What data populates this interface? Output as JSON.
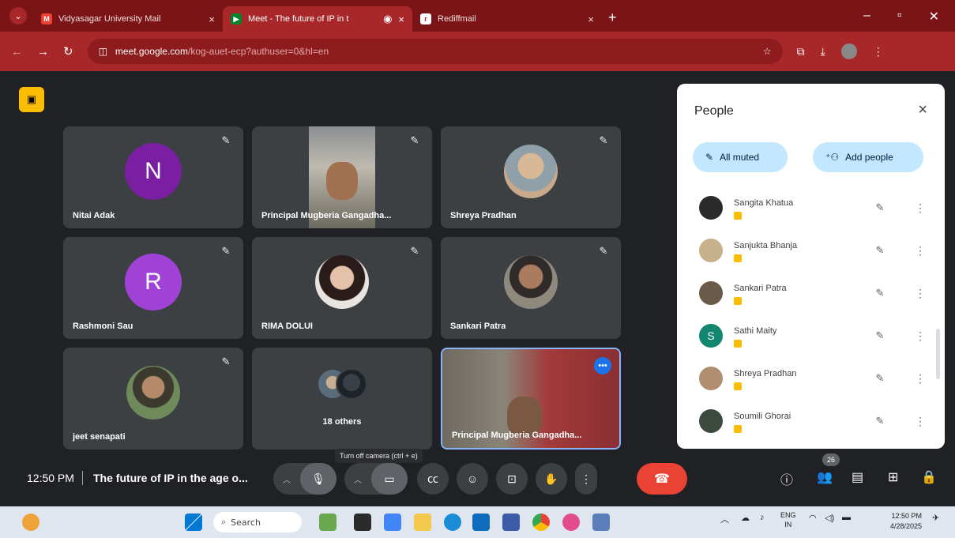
{
  "browser": {
    "tabs": [
      {
        "title": "Vidyasagar University Mail",
        "close": "×",
        "favicon_color": "#ea4335",
        "favicon_glyph": "M"
      },
      {
        "title": "Meet - The future of IP in t",
        "close": "×",
        "favicon_color": "#00832d",
        "favicon_glyph": "▶"
      },
      {
        "title": "Rediffmail",
        "close": "×",
        "favicon_color": "#ffffff",
        "favicon_glyph": "r"
      }
    ],
    "new_tab": "+",
    "address": {
      "host": "meet.google.com",
      "path": "/kog-auet-ecp?authuser=0&hl=en"
    }
  },
  "tiles": [
    {
      "name": "Nitai Adak",
      "kind": "letter",
      "letter": "N",
      "color": "#7b1fa2"
    },
    {
      "name": "Principal Mugberia Gangadha...",
      "kind": "video"
    },
    {
      "name": "Shreya Pradhan",
      "kind": "photo",
      "color": "#c9a98a"
    },
    {
      "name": "Rashmoni Sau",
      "kind": "letter",
      "letter": "R",
      "color": "#a142d6"
    },
    {
      "name": "RIMA DOLUI",
      "kind": "photo",
      "color": "#d8b6a4"
    },
    {
      "name": "Sankari Patra",
      "kind": "photo",
      "color": "#7b6a5d"
    },
    {
      "name": "jeet senapati",
      "kind": "photo",
      "color": "#6e8a5a"
    },
    {
      "name": "18 others",
      "kind": "others"
    },
    {
      "name": "Principal Mugberia Gangadha...",
      "kind": "self"
    }
  ],
  "people_panel": {
    "title": "People",
    "close": "×",
    "all_muted_label": "All muted",
    "add_people_label": "Add people",
    "participants": [
      {
        "name": "Sangita Khatua",
        "avatar_color": "#2b2b2b",
        "letter": ""
      },
      {
        "name": "Sanjukta Bhanja",
        "avatar_color": "#c7b08c",
        "letter": ""
      },
      {
        "name": "Sankari Patra",
        "avatar_color": "#6a5a4a",
        "letter": ""
      },
      {
        "name": "Sathi Maity",
        "avatar_color": "#12866e",
        "letter": "S"
      },
      {
        "name": "Shreya Pradhan",
        "avatar_color": "#b08f70",
        "letter": ""
      },
      {
        "name": "Soumili Ghorai",
        "avatar_color": "#3b4a3c",
        "letter": ""
      }
    ]
  },
  "bottom_bar": {
    "time": "12:50 PM",
    "meeting_title": "The future of IP in the age o...",
    "tooltip": "Turn off camera (ctrl + e)",
    "participant_count": "26"
  },
  "taskbar": {
    "search_placeholder": "Search",
    "lang_top": "ENG",
    "lang_bottom": "IN",
    "clock_time": "12:50 PM",
    "clock_date": "4/28/2025"
  },
  "colors": {
    "chrome_dark": "#7a1416",
    "chrome": "#a8282a",
    "meet_bg": "#202124",
    "tile_bg": "#3c4043",
    "end_call": "#ea4335"
  }
}
